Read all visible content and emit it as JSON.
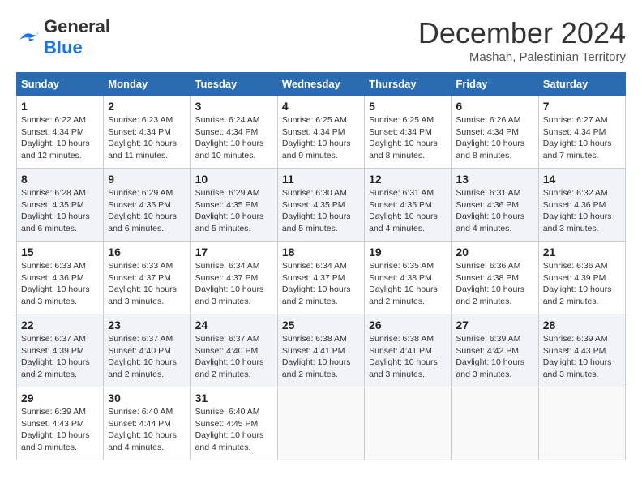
{
  "header": {
    "logo_general": "General",
    "logo_blue": "Blue",
    "month_title": "December 2024",
    "location": "Mashah, Palestinian Territory"
  },
  "days_of_week": [
    "Sunday",
    "Monday",
    "Tuesday",
    "Wednesday",
    "Thursday",
    "Friday",
    "Saturday"
  ],
  "weeks": [
    [
      {
        "day": "1",
        "sunrise": "6:22 AM",
        "sunset": "4:34 PM",
        "daylight": "10 hours and 12 minutes."
      },
      {
        "day": "2",
        "sunrise": "6:23 AM",
        "sunset": "4:34 PM",
        "daylight": "10 hours and 11 minutes."
      },
      {
        "day": "3",
        "sunrise": "6:24 AM",
        "sunset": "4:34 PM",
        "daylight": "10 hours and 10 minutes."
      },
      {
        "day": "4",
        "sunrise": "6:25 AM",
        "sunset": "4:34 PM",
        "daylight": "10 hours and 9 minutes."
      },
      {
        "day": "5",
        "sunrise": "6:25 AM",
        "sunset": "4:34 PM",
        "daylight": "10 hours and 8 minutes."
      },
      {
        "day": "6",
        "sunrise": "6:26 AM",
        "sunset": "4:34 PM",
        "daylight": "10 hours and 8 minutes."
      },
      {
        "day": "7",
        "sunrise": "6:27 AM",
        "sunset": "4:34 PM",
        "daylight": "10 hours and 7 minutes."
      }
    ],
    [
      {
        "day": "8",
        "sunrise": "6:28 AM",
        "sunset": "4:35 PM",
        "daylight": "10 hours and 6 minutes."
      },
      {
        "day": "9",
        "sunrise": "6:29 AM",
        "sunset": "4:35 PM",
        "daylight": "10 hours and 6 minutes."
      },
      {
        "day": "10",
        "sunrise": "6:29 AM",
        "sunset": "4:35 PM",
        "daylight": "10 hours and 5 minutes."
      },
      {
        "day": "11",
        "sunrise": "6:30 AM",
        "sunset": "4:35 PM",
        "daylight": "10 hours and 5 minutes."
      },
      {
        "day": "12",
        "sunrise": "6:31 AM",
        "sunset": "4:35 PM",
        "daylight": "10 hours and 4 minutes."
      },
      {
        "day": "13",
        "sunrise": "6:31 AM",
        "sunset": "4:36 PM",
        "daylight": "10 hours and 4 minutes."
      },
      {
        "day": "14",
        "sunrise": "6:32 AM",
        "sunset": "4:36 PM",
        "daylight": "10 hours and 3 minutes."
      }
    ],
    [
      {
        "day": "15",
        "sunrise": "6:33 AM",
        "sunset": "4:36 PM",
        "daylight": "10 hours and 3 minutes."
      },
      {
        "day": "16",
        "sunrise": "6:33 AM",
        "sunset": "4:37 PM",
        "daylight": "10 hours and 3 minutes."
      },
      {
        "day": "17",
        "sunrise": "6:34 AM",
        "sunset": "4:37 PM",
        "daylight": "10 hours and 3 minutes."
      },
      {
        "day": "18",
        "sunrise": "6:34 AM",
        "sunset": "4:37 PM",
        "daylight": "10 hours and 2 minutes."
      },
      {
        "day": "19",
        "sunrise": "6:35 AM",
        "sunset": "4:38 PM",
        "daylight": "10 hours and 2 minutes."
      },
      {
        "day": "20",
        "sunrise": "6:36 AM",
        "sunset": "4:38 PM",
        "daylight": "10 hours and 2 minutes."
      },
      {
        "day": "21",
        "sunrise": "6:36 AM",
        "sunset": "4:39 PM",
        "daylight": "10 hours and 2 minutes."
      }
    ],
    [
      {
        "day": "22",
        "sunrise": "6:37 AM",
        "sunset": "4:39 PM",
        "daylight": "10 hours and 2 minutes."
      },
      {
        "day": "23",
        "sunrise": "6:37 AM",
        "sunset": "4:40 PM",
        "daylight": "10 hours and 2 minutes."
      },
      {
        "day": "24",
        "sunrise": "6:37 AM",
        "sunset": "4:40 PM",
        "daylight": "10 hours and 2 minutes."
      },
      {
        "day": "25",
        "sunrise": "6:38 AM",
        "sunset": "4:41 PM",
        "daylight": "10 hours and 2 minutes."
      },
      {
        "day": "26",
        "sunrise": "6:38 AM",
        "sunset": "4:41 PM",
        "daylight": "10 hours and 3 minutes."
      },
      {
        "day": "27",
        "sunrise": "6:39 AM",
        "sunset": "4:42 PM",
        "daylight": "10 hours and 3 minutes."
      },
      {
        "day": "28",
        "sunrise": "6:39 AM",
        "sunset": "4:43 PM",
        "daylight": "10 hours and 3 minutes."
      }
    ],
    [
      {
        "day": "29",
        "sunrise": "6:39 AM",
        "sunset": "4:43 PM",
        "daylight": "10 hours and 3 minutes."
      },
      {
        "day": "30",
        "sunrise": "6:40 AM",
        "sunset": "4:44 PM",
        "daylight": "10 hours and 4 minutes."
      },
      {
        "day": "31",
        "sunrise": "6:40 AM",
        "sunset": "4:45 PM",
        "daylight": "10 hours and 4 minutes."
      },
      null,
      null,
      null,
      null
    ]
  ]
}
